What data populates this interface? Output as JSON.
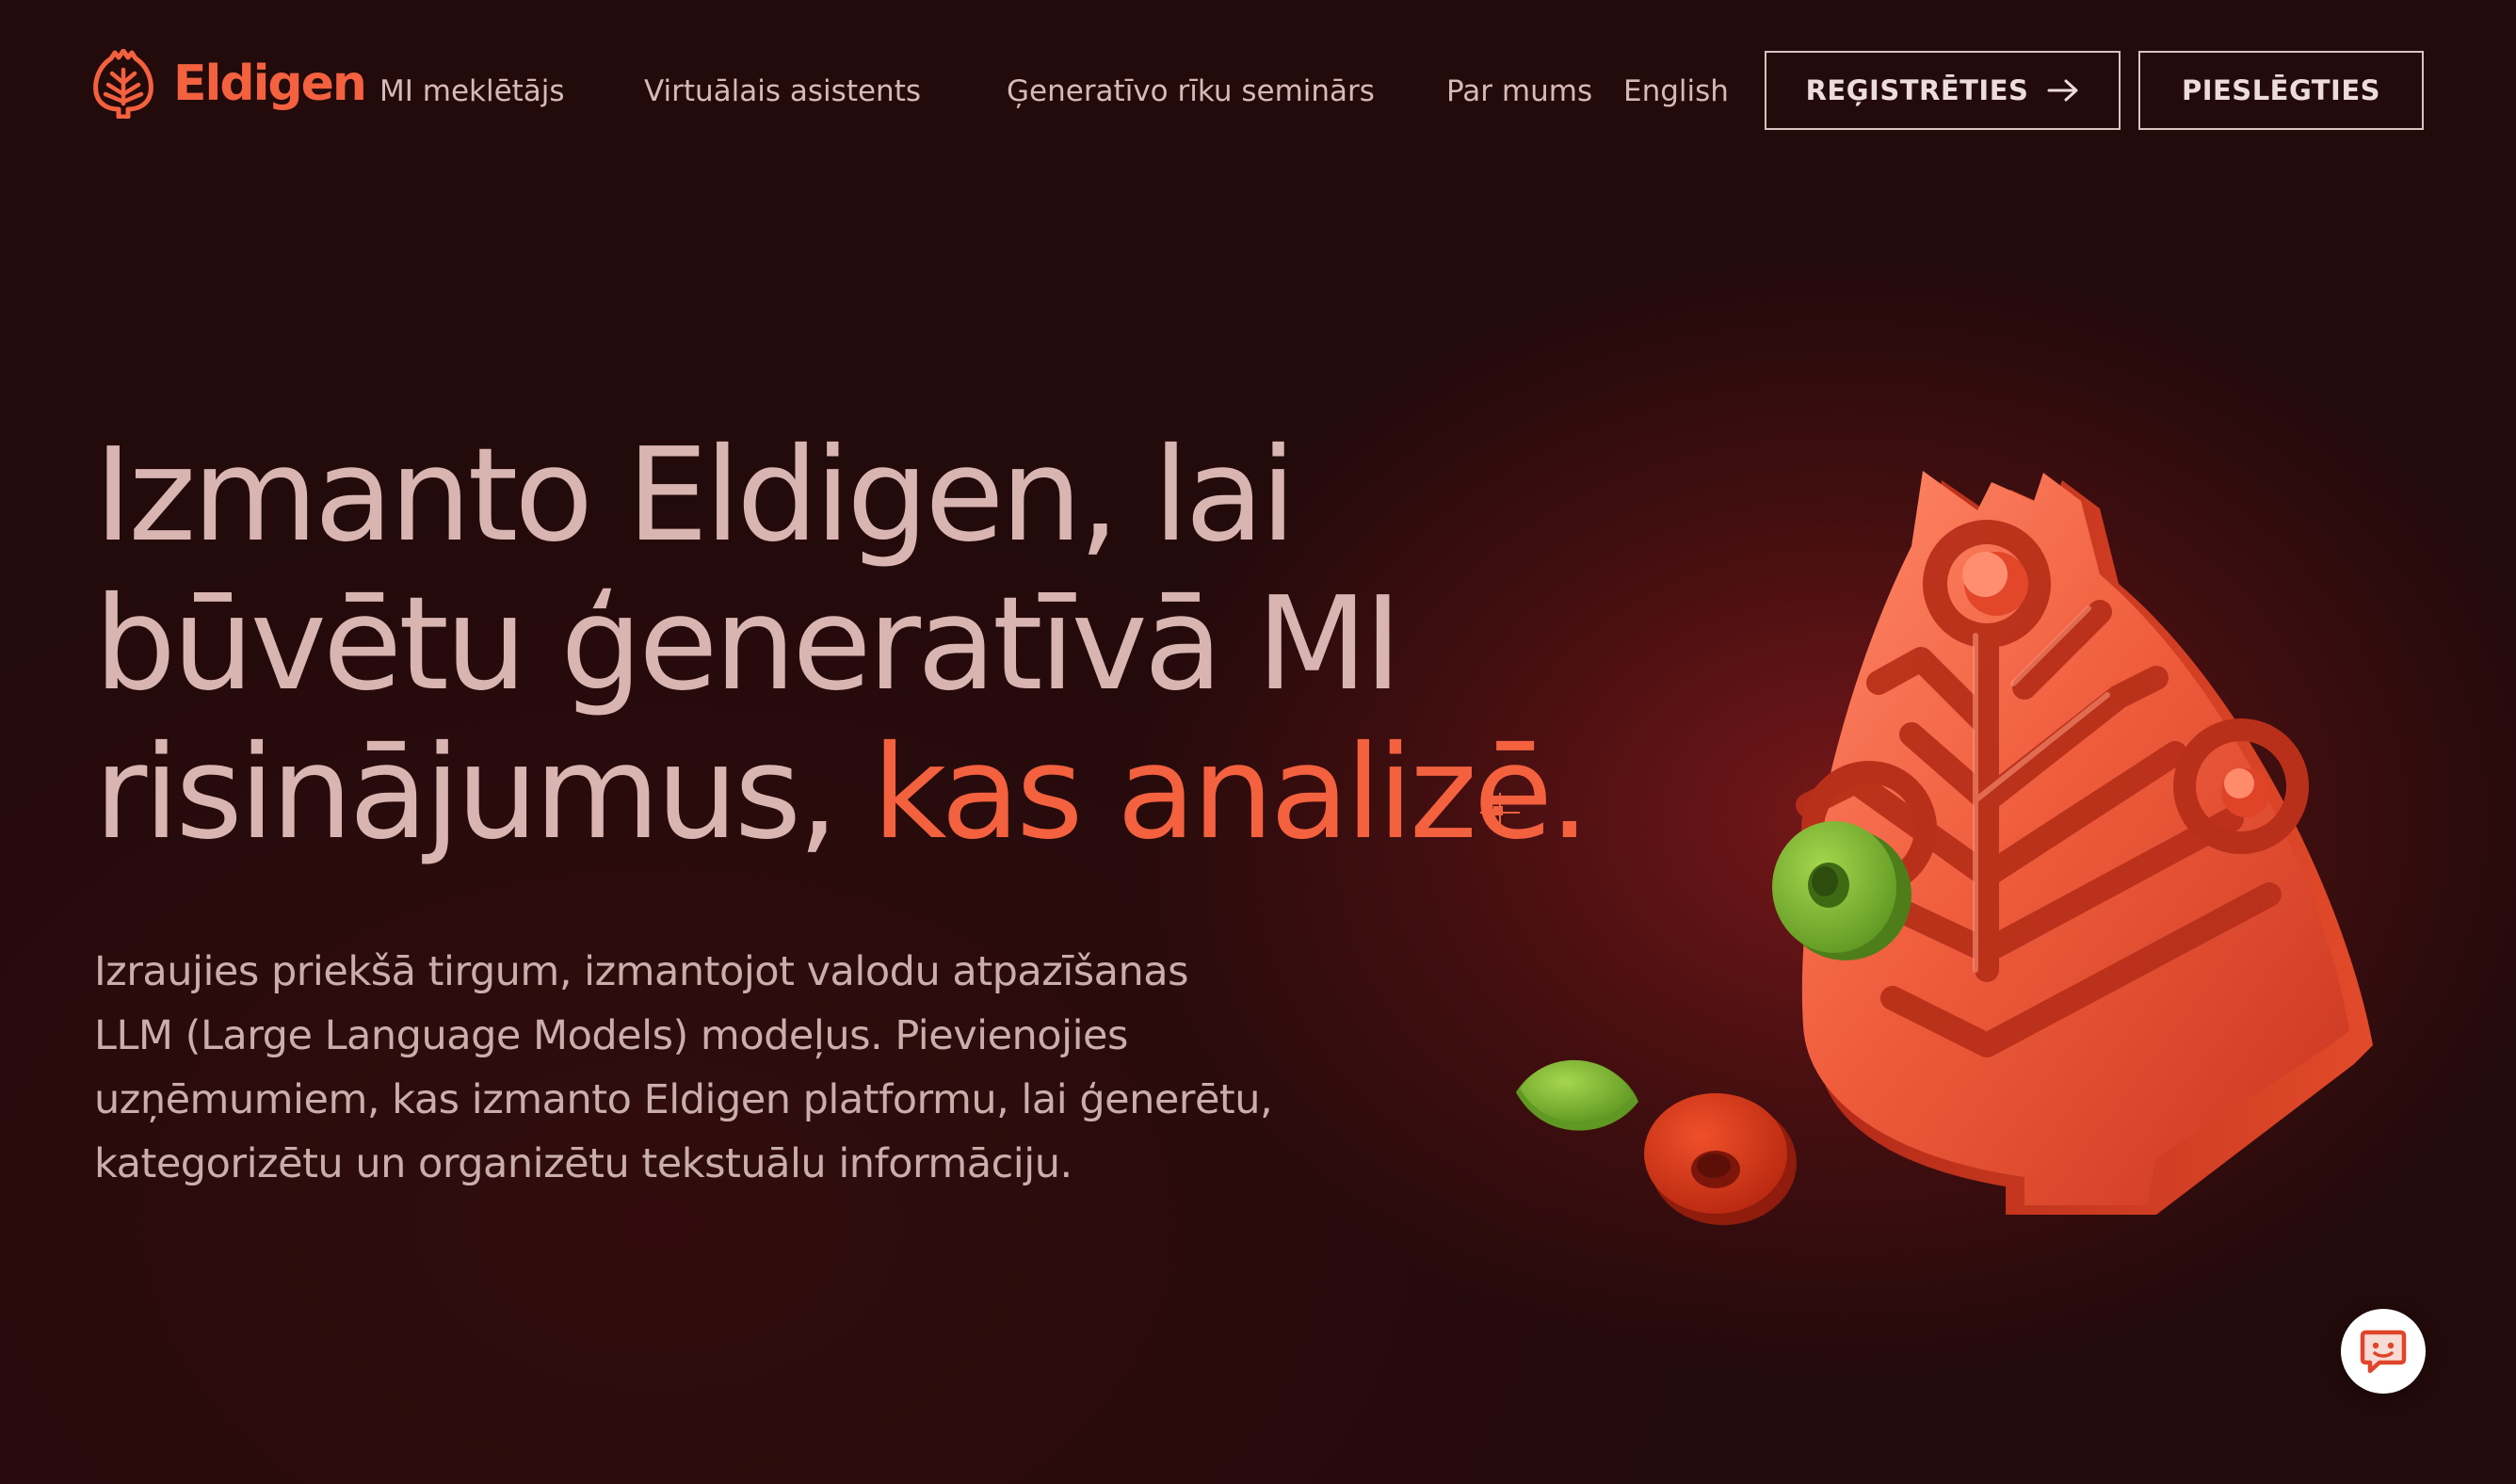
{
  "nav": {
    "brand": "Eldigen",
    "links": [
      {
        "label": "MI meklētājs"
      },
      {
        "label": "Virtuālais asistents"
      },
      {
        "label": "Ģeneratīvo rīku seminārs"
      },
      {
        "label": "Par mums"
      },
      {
        "label": "English"
      }
    ],
    "register_label": "REĢISTRĒTIES",
    "login_label": "PIESLĒGTIES"
  },
  "hero": {
    "title_line_1": "Izmanto Eldigen, lai",
    "title_line_2": "būvētu ģeneratīvā MI",
    "title_line_3": "risinājumus, ",
    "title_accent": "kas analizē.",
    "subtitle_lines": [
      "Izraujies priekšā tirgum, izmantojot valodu atpazīšanas",
      "LLM (Large Language Models) modeļus. Pievienojies",
      "uzņēmumiem, kas izmanto Eldigen platformu, lai ģenerētu,",
      "kategorizētu un organizētu tekstuālu informāciju."
    ]
  },
  "icons": {
    "logo": "leaf-tree-icon",
    "register_arrow": "arrow-right-icon",
    "chat": "chat-bubble-icon",
    "cursor": "text-cursor-icon"
  },
  "colors": {
    "background": "#230a0b",
    "accent": "#f3613f",
    "headline": "#d9b5b2",
    "body_text": "#c9aeab",
    "leaf_green": "#7fb53a"
  }
}
